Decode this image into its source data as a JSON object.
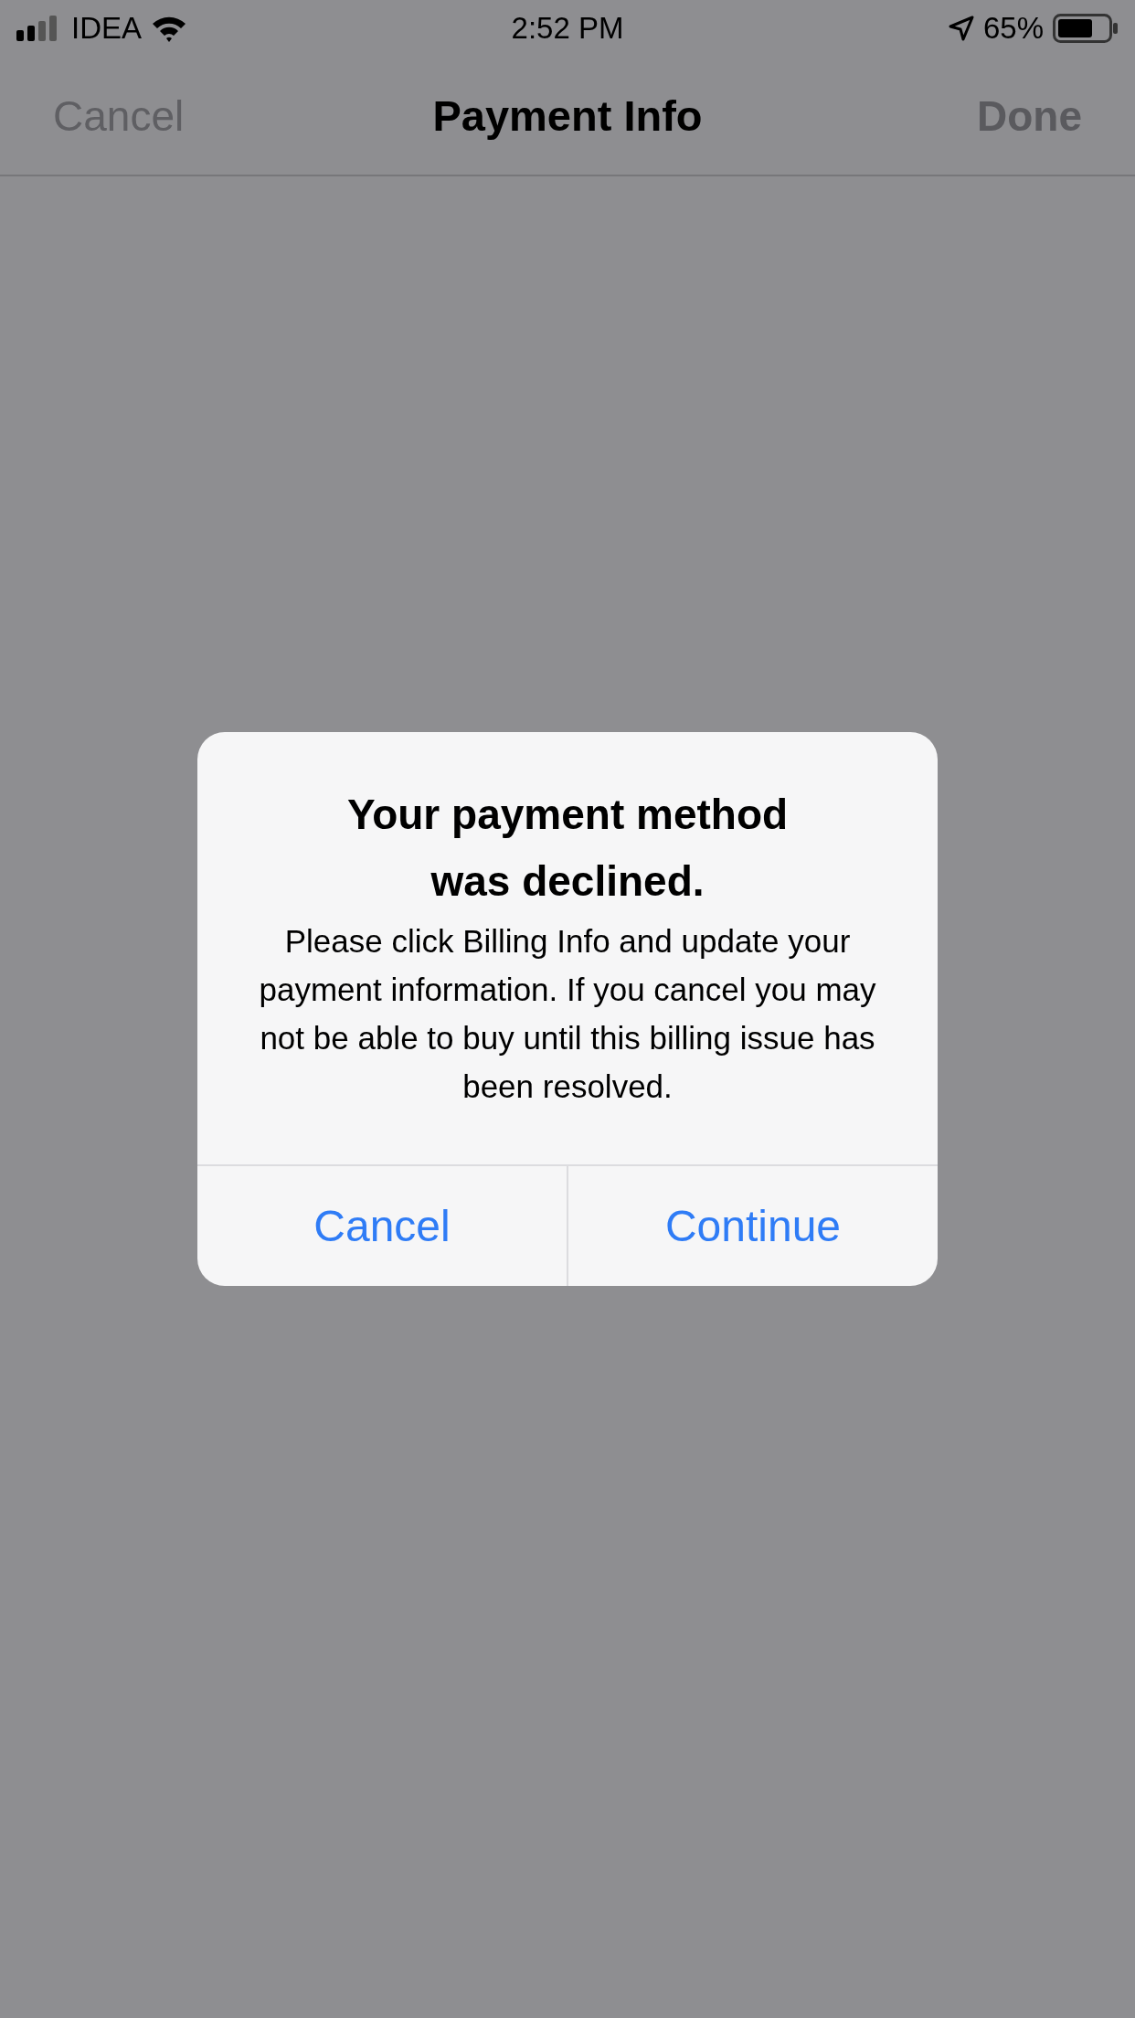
{
  "status_bar": {
    "carrier": "IDEA",
    "time": "2:52 PM",
    "battery": "65%"
  },
  "nav_bar": {
    "title": "Payment Info",
    "left": {
      "label": "Cancel",
      "disabled": true
    },
    "right": {
      "label": "Done",
      "disabled": true
    }
  },
  "alert": {
    "title": "Your payment method was declined.",
    "message": "Please click Billing Info and update your payment information. If you cancel you may not be able to buy until this billing issue has been resolved.",
    "buttons": [
      {
        "label": "Cancel"
      },
      {
        "label": "Continue"
      }
    ]
  }
}
